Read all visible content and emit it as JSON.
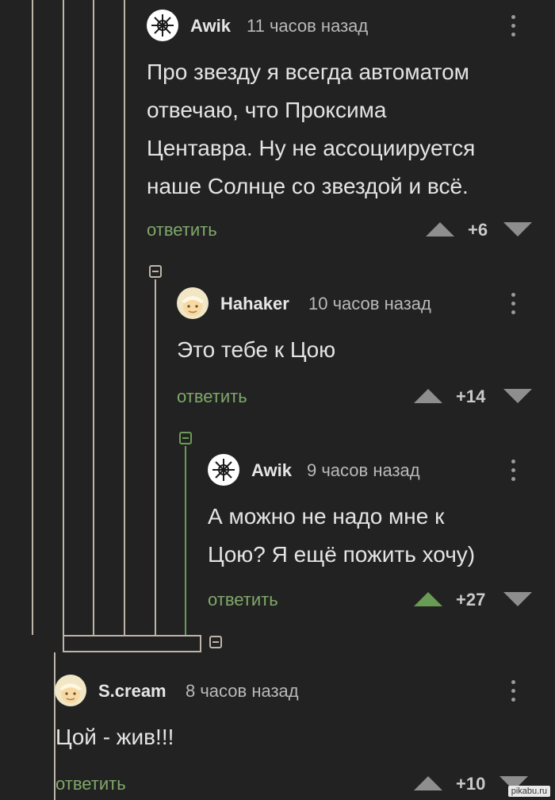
{
  "comments": [
    {
      "author": "Awik",
      "time": "11 часов назад",
      "text_lines": [
        "Про звезду я всегда автоматом",
        "отвечаю, что Проксима",
        "Центавра. Ну не ассоциируется",
        "наше Солнце со звездой и всё."
      ],
      "reply_label": "ответить",
      "score": "+6",
      "avatar_icon": "star-emblem-icon"
    },
    {
      "author": "Hahaker",
      "time": "10 часов назад",
      "text_lines": [
        "Это тебе к Цою"
      ],
      "reply_label": "ответить",
      "score": "+14",
      "avatar_icon": "cartoon-avatar-icon"
    },
    {
      "author": "Awik",
      "time": "9 часов назад",
      "text_lines": [
        "А можно не надо мне к",
        "Цою? Я ещё пожить хочу)"
      ],
      "reply_label": "ответить",
      "score": "+27",
      "upvoted": true,
      "avatar_icon": "star-emblem-icon"
    },
    {
      "author": "S.cream",
      "time": "8 часов назад",
      "text_lines": [
        "Цой - жив!!!"
      ],
      "reply_label": "ответить",
      "score": "+10",
      "avatar_icon": "cartoon-avatar-icon"
    }
  ],
  "watermark": "pikabu.ru",
  "colors": {
    "background": "#222222",
    "thread_line": "#bdb5a8",
    "active_thread": "#6a9b55",
    "reply_link": "#7fa86a",
    "upvote_active": "#6a9b55"
  }
}
